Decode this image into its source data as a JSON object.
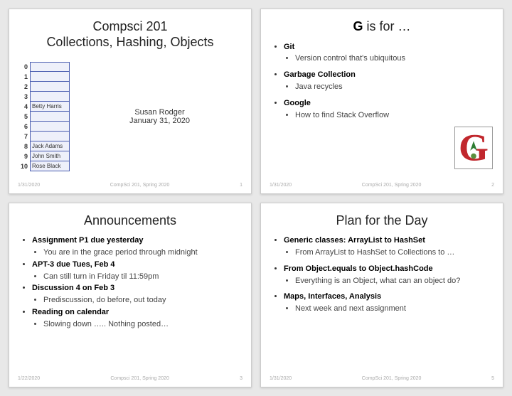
{
  "slide1": {
    "title": "Compsci 201\nCollections, Hashing, Objects",
    "author": "Susan Rodger",
    "date": "January 31, 2020",
    "array": [
      {
        "i": "0",
        "v": ""
      },
      {
        "i": "1",
        "v": ""
      },
      {
        "i": "2",
        "v": ""
      },
      {
        "i": "3",
        "v": ""
      },
      {
        "i": "4",
        "v": "Betty Harris"
      },
      {
        "i": "5",
        "v": ""
      },
      {
        "i": "6",
        "v": ""
      },
      {
        "i": "7",
        "v": ""
      },
      {
        "i": "8",
        "v": "Jack Adams"
      },
      {
        "i": "9",
        "v": "John Smith"
      },
      {
        "i": "10",
        "v": "Rose Black"
      }
    ],
    "footer": {
      "date": "1/31/2020",
      "course": "CompSci 201, Spring 2020",
      "num": "1"
    }
  },
  "slide2": {
    "title_prefix": "G",
    "title_suffix": "  is for …",
    "items": [
      {
        "head": "Git",
        "sub": "Version control that's ubiquitous"
      },
      {
        "head": "Garbage Collection",
        "sub": "Java recycles"
      },
      {
        "head": "Google",
        "sub": "How to find Stack Overflow"
      }
    ],
    "footer": {
      "date": "1/31/2020",
      "course": "CompSci 201, Spring 2020",
      "num": "2"
    }
  },
  "slide3": {
    "title": "Announcements",
    "items": [
      {
        "head": "Assignment P1 due yesterday",
        "sub": "You are in the grace period through midnight"
      },
      {
        "head": "APT-3 due Tues, Feb 4",
        "sub": "Can still turn in Friday til 11:59pm"
      },
      {
        "head": "Discussion 4 on Feb 3",
        "sub": "Prediscussion, do before, out today"
      },
      {
        "head": "Reading on calendar",
        "sub": "Slowing down ….. Nothing posted…"
      }
    ],
    "footer": {
      "date": "1/22/2020",
      "course": "Compsci 201, Spring 2020",
      "num": "3"
    }
  },
  "slide4": {
    "title": "Plan for the Day",
    "items": [
      {
        "head": "Generic classes: ArrayList to HashSet",
        "sub": "From ArrayList to HashSet to Collections to …"
      },
      {
        "head": "From Object.equals to Object.hashCode",
        "sub": "Everything is an Object, what can an object do?"
      },
      {
        "head": "Maps, Interfaces, Analysis",
        "sub": "Next week and next assignment"
      }
    ],
    "footer": {
      "date": "1/31/2020",
      "course": "CompSci 201, Spring 2020",
      "num": "5"
    }
  }
}
